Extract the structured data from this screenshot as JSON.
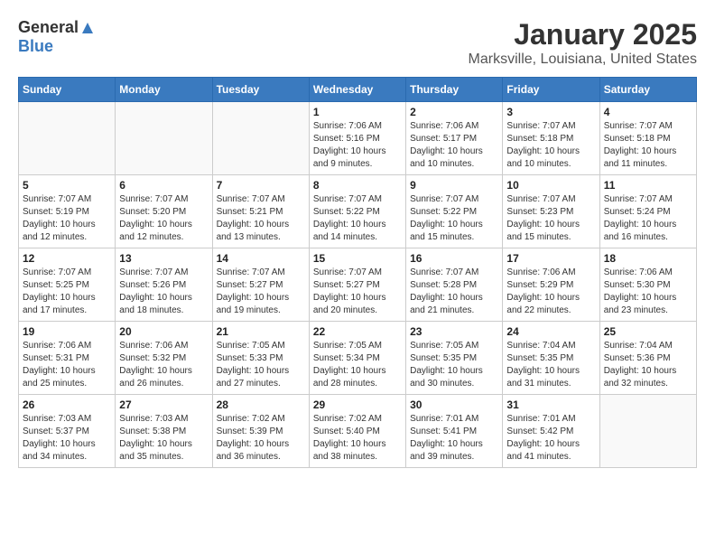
{
  "logo": {
    "general": "General",
    "blue": "Blue"
  },
  "title": "January 2025",
  "location": "Marksville, Louisiana, United States",
  "days_of_week": [
    "Sunday",
    "Monday",
    "Tuesday",
    "Wednesday",
    "Thursday",
    "Friday",
    "Saturday"
  ],
  "weeks": [
    [
      {
        "day": "",
        "info": ""
      },
      {
        "day": "",
        "info": ""
      },
      {
        "day": "",
        "info": ""
      },
      {
        "day": "1",
        "info": "Sunrise: 7:06 AM\nSunset: 5:16 PM\nDaylight: 10 hours\nand 9 minutes."
      },
      {
        "day": "2",
        "info": "Sunrise: 7:06 AM\nSunset: 5:17 PM\nDaylight: 10 hours\nand 10 minutes."
      },
      {
        "day": "3",
        "info": "Sunrise: 7:07 AM\nSunset: 5:18 PM\nDaylight: 10 hours\nand 10 minutes."
      },
      {
        "day": "4",
        "info": "Sunrise: 7:07 AM\nSunset: 5:18 PM\nDaylight: 10 hours\nand 11 minutes."
      }
    ],
    [
      {
        "day": "5",
        "info": "Sunrise: 7:07 AM\nSunset: 5:19 PM\nDaylight: 10 hours\nand 12 minutes."
      },
      {
        "day": "6",
        "info": "Sunrise: 7:07 AM\nSunset: 5:20 PM\nDaylight: 10 hours\nand 12 minutes."
      },
      {
        "day": "7",
        "info": "Sunrise: 7:07 AM\nSunset: 5:21 PM\nDaylight: 10 hours\nand 13 minutes."
      },
      {
        "day": "8",
        "info": "Sunrise: 7:07 AM\nSunset: 5:22 PM\nDaylight: 10 hours\nand 14 minutes."
      },
      {
        "day": "9",
        "info": "Sunrise: 7:07 AM\nSunset: 5:22 PM\nDaylight: 10 hours\nand 15 minutes."
      },
      {
        "day": "10",
        "info": "Sunrise: 7:07 AM\nSunset: 5:23 PM\nDaylight: 10 hours\nand 15 minutes."
      },
      {
        "day": "11",
        "info": "Sunrise: 7:07 AM\nSunset: 5:24 PM\nDaylight: 10 hours\nand 16 minutes."
      }
    ],
    [
      {
        "day": "12",
        "info": "Sunrise: 7:07 AM\nSunset: 5:25 PM\nDaylight: 10 hours\nand 17 minutes."
      },
      {
        "day": "13",
        "info": "Sunrise: 7:07 AM\nSunset: 5:26 PM\nDaylight: 10 hours\nand 18 minutes."
      },
      {
        "day": "14",
        "info": "Sunrise: 7:07 AM\nSunset: 5:27 PM\nDaylight: 10 hours\nand 19 minutes."
      },
      {
        "day": "15",
        "info": "Sunrise: 7:07 AM\nSunset: 5:27 PM\nDaylight: 10 hours\nand 20 minutes."
      },
      {
        "day": "16",
        "info": "Sunrise: 7:07 AM\nSunset: 5:28 PM\nDaylight: 10 hours\nand 21 minutes."
      },
      {
        "day": "17",
        "info": "Sunrise: 7:06 AM\nSunset: 5:29 PM\nDaylight: 10 hours\nand 22 minutes."
      },
      {
        "day": "18",
        "info": "Sunrise: 7:06 AM\nSunset: 5:30 PM\nDaylight: 10 hours\nand 23 minutes."
      }
    ],
    [
      {
        "day": "19",
        "info": "Sunrise: 7:06 AM\nSunset: 5:31 PM\nDaylight: 10 hours\nand 25 minutes."
      },
      {
        "day": "20",
        "info": "Sunrise: 7:06 AM\nSunset: 5:32 PM\nDaylight: 10 hours\nand 26 minutes."
      },
      {
        "day": "21",
        "info": "Sunrise: 7:05 AM\nSunset: 5:33 PM\nDaylight: 10 hours\nand 27 minutes."
      },
      {
        "day": "22",
        "info": "Sunrise: 7:05 AM\nSunset: 5:34 PM\nDaylight: 10 hours\nand 28 minutes."
      },
      {
        "day": "23",
        "info": "Sunrise: 7:05 AM\nSunset: 5:35 PM\nDaylight: 10 hours\nand 30 minutes."
      },
      {
        "day": "24",
        "info": "Sunrise: 7:04 AM\nSunset: 5:35 PM\nDaylight: 10 hours\nand 31 minutes."
      },
      {
        "day": "25",
        "info": "Sunrise: 7:04 AM\nSunset: 5:36 PM\nDaylight: 10 hours\nand 32 minutes."
      }
    ],
    [
      {
        "day": "26",
        "info": "Sunrise: 7:03 AM\nSunset: 5:37 PM\nDaylight: 10 hours\nand 34 minutes."
      },
      {
        "day": "27",
        "info": "Sunrise: 7:03 AM\nSunset: 5:38 PM\nDaylight: 10 hours\nand 35 minutes."
      },
      {
        "day": "28",
        "info": "Sunrise: 7:02 AM\nSunset: 5:39 PM\nDaylight: 10 hours\nand 36 minutes."
      },
      {
        "day": "29",
        "info": "Sunrise: 7:02 AM\nSunset: 5:40 PM\nDaylight: 10 hours\nand 38 minutes."
      },
      {
        "day": "30",
        "info": "Sunrise: 7:01 AM\nSunset: 5:41 PM\nDaylight: 10 hours\nand 39 minutes."
      },
      {
        "day": "31",
        "info": "Sunrise: 7:01 AM\nSunset: 5:42 PM\nDaylight: 10 hours\nand 41 minutes."
      },
      {
        "day": "",
        "info": ""
      }
    ]
  ]
}
